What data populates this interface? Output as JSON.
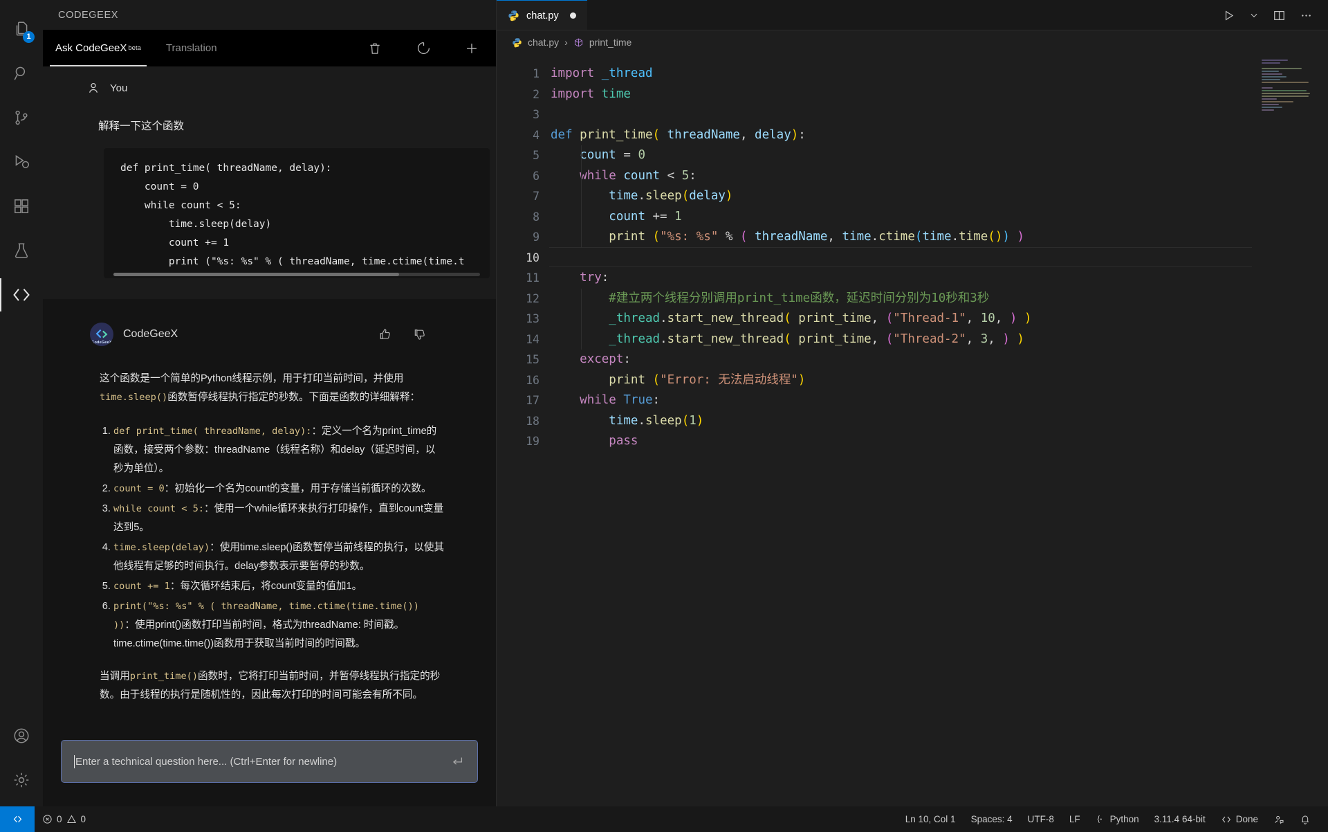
{
  "activitybar": {
    "items": [
      {
        "name": "explorer",
        "icon": "files-icon",
        "badge": "1",
        "active": false
      },
      {
        "name": "search",
        "icon": "search-icon",
        "badge": "",
        "active": false
      },
      {
        "name": "source-control",
        "icon": "source-control-icon",
        "badge": "",
        "active": false
      },
      {
        "name": "run-and-debug",
        "icon": "run-debug-icon",
        "badge": "",
        "active": false
      },
      {
        "name": "extensions",
        "icon": "extensions-icon",
        "badge": "",
        "active": false
      },
      {
        "name": "testing",
        "icon": "beaker-icon",
        "badge": "",
        "active": false
      },
      {
        "name": "codegeex",
        "icon": "code-brackets-icon",
        "badge": "",
        "active": true
      }
    ],
    "bottom": [
      {
        "name": "accounts",
        "icon": "account-icon"
      },
      {
        "name": "manage",
        "icon": "gear-icon"
      }
    ]
  },
  "codegeex": {
    "panel_title": "CODEGEEX",
    "tabs": [
      {
        "label": "Ask CodeGeeX",
        "sup": "beta",
        "active": true
      },
      {
        "label": "Translation",
        "sup": "",
        "active": false
      }
    ],
    "actions": [
      {
        "name": "delete-conversation",
        "icon": "trash-icon"
      },
      {
        "name": "refresh-conversation",
        "icon": "history-icon"
      },
      {
        "name": "new-conversation",
        "icon": "plus-icon"
      }
    ],
    "user_message": {
      "author": "You",
      "question": "解释一下这个函数",
      "code": "def print_time( threadName, delay):\n    count = 0\n    while count < 5:\n        time.sleep(delay)\n        count += 1\n        print (\"%s: %s\" % ( threadName, time.ctime(time.t"
    },
    "bot_message": {
      "author": "CodeGeeX",
      "avatar_label": "CodeGeeX",
      "tools": [
        {
          "name": "thumbs-up",
          "icon": "thumbs-up-icon"
        },
        {
          "name": "thumbs-down",
          "icon": "thumbs-down-icon"
        }
      ],
      "intro_1": "这个函数是一个简单的Python线程示例，用于打印当前时间，并使用",
      "intro_code": "time.sleep()",
      "intro_2": "函数暂停线程执行指定的秒数。下面是函数的详细解释：",
      "list": [
        {
          "code": "def print_time( threadName, delay):",
          "text": "：定义一个名为print_time的函数，接受两个参数：threadName（线程名称）和delay（延迟时间，以秒为单位）。"
        },
        {
          "code": "count = 0",
          "text": "：初始化一个名为count的变量，用于存储当前循环的次数。"
        },
        {
          "code": "while count < 5:",
          "text": "：使用一个while循环来执行打印操作，直到count变量达到5。"
        },
        {
          "code": "time.sleep(delay)",
          "text": "：使用time.sleep()函数暂停当前线程的执行，以使其他线程有足够的时间执行。delay参数表示要暂停的秒数。"
        },
        {
          "code": "count += 1",
          "text": "：每次循环结束后，将count变量的值加1。"
        },
        {
          "code": "print(\"%s: %s\" % ( threadName, time.ctime(time.time()) ))",
          "text": "：使用print()函数打印当前时间，格式为threadName: 时间戳。time.ctime(time.time())函数用于获取当前时间的时间戳。"
        }
      ],
      "outro_code": "print_time()",
      "outro_1": "当调用",
      "outro_2": "函数时，它将打印当前时间，并暂停线程执行指定的秒数。由于线程的执行是随机性的，因此每次打印的时间可能会有所不同。"
    },
    "input": {
      "placeholder": "Enter a technical question here... (Ctrl+Enter for newline)",
      "value": "",
      "submit_icon": "enter-arrow-icon"
    }
  },
  "editor": {
    "tab": {
      "filename": "chat.py",
      "icon": "python-icon",
      "dirty": true
    },
    "tab_actions": [
      {
        "name": "run-python-file",
        "icon": "play-icon"
      },
      {
        "name": "run-dropdown",
        "icon": "chevron-down-icon"
      },
      {
        "name": "split-editor",
        "icon": "split-editor-icon"
      },
      {
        "name": "more-actions",
        "icon": "ellipsis-icon"
      }
    ],
    "breadcrumb": [
      {
        "label": "chat.py",
        "icon": "python-icon"
      },
      {
        "label": "print_time",
        "icon": "symbol-method-icon"
      }
    ],
    "current_line": 10,
    "lines": [
      {
        "n": 1,
        "tokens": [
          {
            "t": "import",
            "c": "kw"
          },
          {
            "t": " ",
            "c": "pun"
          },
          {
            "t": "_thread",
            "c": "ty"
          }
        ]
      },
      {
        "n": 2,
        "tokens": [
          {
            "t": "import",
            "c": "kw"
          },
          {
            "t": " ",
            "c": "pun"
          },
          {
            "t": "time",
            "c": "id"
          }
        ]
      },
      {
        "n": 3,
        "tokens": []
      },
      {
        "n": 4,
        "tokens": [
          {
            "t": "def",
            "c": "kw2"
          },
          {
            "t": " ",
            "c": "pun"
          },
          {
            "t": "print_time",
            "c": "fn"
          },
          {
            "t": "(",
            "c": "y"
          },
          {
            "t": " ",
            "c": "pun"
          },
          {
            "t": "threadName",
            "c": "var"
          },
          {
            "t": ", ",
            "c": "pun"
          },
          {
            "t": "delay",
            "c": "var"
          },
          {
            "t": ")",
            "c": "y"
          },
          {
            "t": ":",
            "c": "pun"
          }
        ]
      },
      {
        "n": 5,
        "tokens": [
          {
            "t": "    ",
            "c": "pun"
          },
          {
            "t": "count",
            "c": "var"
          },
          {
            "t": " = ",
            "c": "pun"
          },
          {
            "t": "0",
            "c": "num"
          }
        ]
      },
      {
        "n": 6,
        "tokens": [
          {
            "t": "    ",
            "c": "pun"
          },
          {
            "t": "while",
            "c": "kw"
          },
          {
            "t": " ",
            "c": "pun"
          },
          {
            "t": "count",
            "c": "var"
          },
          {
            "t": " < ",
            "c": "pun"
          },
          {
            "t": "5",
            "c": "num"
          },
          {
            "t": ":",
            "c": "pun"
          }
        ]
      },
      {
        "n": 7,
        "tokens": [
          {
            "t": "        ",
            "c": "pun"
          },
          {
            "t": "time",
            "c": "var"
          },
          {
            "t": ".",
            "c": "pun"
          },
          {
            "t": "sleep",
            "c": "fn"
          },
          {
            "t": "(",
            "c": "y"
          },
          {
            "t": "delay",
            "c": "var"
          },
          {
            "t": ")",
            "c": "y"
          }
        ]
      },
      {
        "n": 8,
        "tokens": [
          {
            "t": "        ",
            "c": "pun"
          },
          {
            "t": "count",
            "c": "var"
          },
          {
            "t": " += ",
            "c": "pun"
          },
          {
            "t": "1",
            "c": "num"
          }
        ]
      },
      {
        "n": 9,
        "tokens": [
          {
            "t": "        ",
            "c": "pun"
          },
          {
            "t": "print",
            "c": "fn"
          },
          {
            "t": " (",
            "c": "y"
          },
          {
            "t": "\"%s: %s\"",
            "c": "str"
          },
          {
            "t": " % ",
            "c": "pun"
          },
          {
            "t": "(",
            "c": "m"
          },
          {
            "t": " ",
            "c": "pun"
          },
          {
            "t": "threadName",
            "c": "var"
          },
          {
            "t": ", ",
            "c": "pun"
          },
          {
            "t": "time",
            "c": "var"
          },
          {
            "t": ".",
            "c": "pun"
          },
          {
            "t": "ctime",
            "c": "fn"
          },
          {
            "t": "(",
            "c": "ty"
          },
          {
            "t": "time",
            "c": "var"
          },
          {
            "t": ".",
            "c": "pun"
          },
          {
            "t": "time",
            "c": "fn"
          },
          {
            "t": "()",
            "c": "y"
          },
          {
            "t": ") ",
            "c": "ty"
          },
          {
            "t": ")",
            "c": "m"
          }
        ]
      },
      {
        "n": 10,
        "tokens": []
      },
      {
        "n": 11,
        "tokens": [
          {
            "t": "    ",
            "c": "pun"
          },
          {
            "t": "try",
            "c": "kw"
          },
          {
            "t": ":",
            "c": "pun"
          }
        ]
      },
      {
        "n": 12,
        "tokens": [
          {
            "t": "        ",
            "c": "pun"
          },
          {
            "t": "#建立两个线程分别调用print_time函数，延迟时间分别为10秒和3秒",
            "c": "cmt"
          }
        ]
      },
      {
        "n": 13,
        "tokens": [
          {
            "t": "        ",
            "c": "pun"
          },
          {
            "t": "_thread",
            "c": "id"
          },
          {
            "t": ".",
            "c": "pun"
          },
          {
            "t": "start_new_thread",
            "c": "fn"
          },
          {
            "t": "(",
            "c": "y"
          },
          {
            "t": " ",
            "c": "pun"
          },
          {
            "t": "print_time",
            "c": "fn"
          },
          {
            "t": ", ",
            "c": "pun"
          },
          {
            "t": "(",
            "c": "m"
          },
          {
            "t": "\"Thread-1\"",
            "c": "str"
          },
          {
            "t": ", ",
            "c": "pun"
          },
          {
            "t": "10",
            "c": "num"
          },
          {
            "t": ", ",
            "c": "pun"
          },
          {
            "t": ")",
            "c": "m"
          },
          {
            "t": " ",
            "c": "pun"
          },
          {
            "t": ")",
            "c": "y"
          }
        ]
      },
      {
        "n": 14,
        "tokens": [
          {
            "t": "        ",
            "c": "pun"
          },
          {
            "t": "_thread",
            "c": "id"
          },
          {
            "t": ".",
            "c": "pun"
          },
          {
            "t": "start_new_thread",
            "c": "fn"
          },
          {
            "t": "(",
            "c": "y"
          },
          {
            "t": " ",
            "c": "pun"
          },
          {
            "t": "print_time",
            "c": "fn"
          },
          {
            "t": ", ",
            "c": "pun"
          },
          {
            "t": "(",
            "c": "m"
          },
          {
            "t": "\"Thread-2\"",
            "c": "str"
          },
          {
            "t": ", ",
            "c": "pun"
          },
          {
            "t": "3",
            "c": "num"
          },
          {
            "t": ", ",
            "c": "pun"
          },
          {
            "t": ")",
            "c": "m"
          },
          {
            "t": " ",
            "c": "pun"
          },
          {
            "t": ")",
            "c": "y"
          }
        ]
      },
      {
        "n": 15,
        "tokens": [
          {
            "t": "    ",
            "c": "pun"
          },
          {
            "t": "except",
            "c": "kw"
          },
          {
            "t": ":",
            "c": "pun"
          }
        ]
      },
      {
        "n": 16,
        "tokens": [
          {
            "t": "        ",
            "c": "pun"
          },
          {
            "t": "print",
            "c": "fn"
          },
          {
            "t": " (",
            "c": "y"
          },
          {
            "t": "\"Error: 无法启动线程\"",
            "c": "str"
          },
          {
            "t": ")",
            "c": "y"
          }
        ]
      },
      {
        "n": 17,
        "tokens": [
          {
            "t": "    ",
            "c": "pun"
          },
          {
            "t": "while",
            "c": "kw"
          },
          {
            "t": " ",
            "c": "pun"
          },
          {
            "t": "True",
            "c": "kw2"
          },
          {
            "t": ":",
            "c": "pun"
          }
        ]
      },
      {
        "n": 18,
        "tokens": [
          {
            "t": "        ",
            "c": "pun"
          },
          {
            "t": "time",
            "c": "var"
          },
          {
            "t": ".",
            "c": "pun"
          },
          {
            "t": "sleep",
            "c": "fn"
          },
          {
            "t": "(",
            "c": "y"
          },
          {
            "t": "1",
            "c": "num"
          },
          {
            "t": ")",
            "c": "y"
          }
        ]
      },
      {
        "n": 19,
        "tokens": [
          {
            "t": "        ",
            "c": "pun"
          },
          {
            "t": "pass",
            "c": "kw"
          }
        ]
      }
    ]
  },
  "statusbar": {
    "remote_icon": "remote-window-icon",
    "errors": "0",
    "warnings": "0",
    "items": [
      {
        "name": "editor-position",
        "label": "Ln 10, Col 1"
      },
      {
        "name": "indentation",
        "label": "Spaces: 4"
      },
      {
        "name": "encoding",
        "label": "UTF-8"
      },
      {
        "name": "eol",
        "label": "LF"
      },
      {
        "name": "language-mode",
        "label": "Python"
      },
      {
        "name": "python-interpreter",
        "label": "3.11.4 64-bit"
      },
      {
        "name": "codegeex-status",
        "label": "Done"
      }
    ],
    "right_icons": [
      {
        "name": "feedback-icon"
      },
      {
        "name": "bell-icon"
      }
    ]
  },
  "colors": {
    "accent": "#0078d4",
    "editor_bg": "#1e1e1e",
    "panel_bg": "#141414"
  }
}
